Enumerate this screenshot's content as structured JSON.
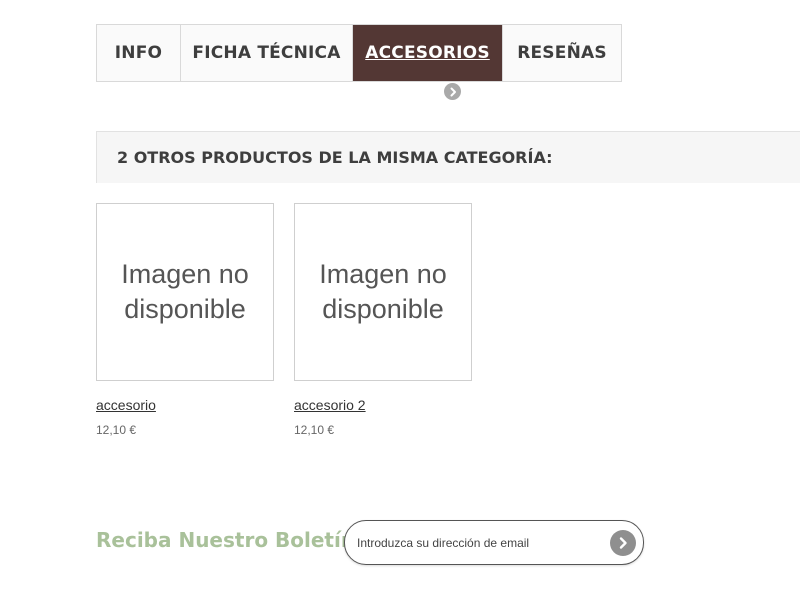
{
  "tabs": [
    {
      "label": "INFO",
      "active": false
    },
    {
      "label": "FICHA TÉCNICA",
      "active": false
    },
    {
      "label": "ACCESORIOS",
      "active": true
    },
    {
      "label": "RESEÑAS",
      "active": false
    }
  ],
  "section": {
    "heading": "2 OTROS PRODUCTOS DE LA MISMA CATEGORÍA:"
  },
  "products": [
    {
      "image_text": "Imagen no disponible",
      "name": "accesorio",
      "price": "12,10 €"
    },
    {
      "image_text": "Imagen no disponible",
      "name": "accesorio 2",
      "price": "12,10 €"
    }
  ],
  "newsletter": {
    "title": "Reciba Nuestro Boletín",
    "placeholder": "Introduzca su dirección de email",
    "submit_icon": "chevron-right-icon"
  },
  "colors": {
    "active_tab_bg": "#533734",
    "newsletter_title": "#a9c19a",
    "icon_gray": "#8f8f8f"
  }
}
